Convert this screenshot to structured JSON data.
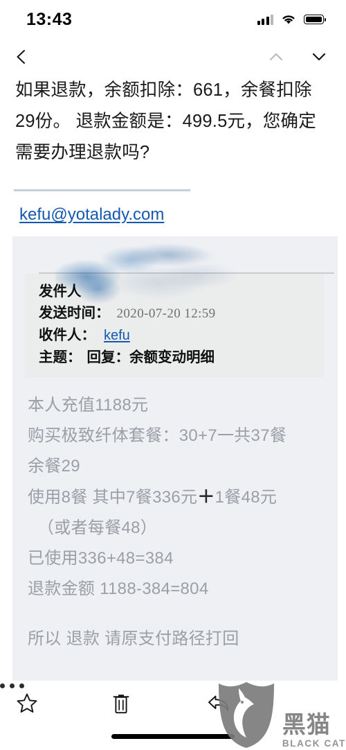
{
  "status_bar": {
    "time": "13:43",
    "icons": [
      "signal-icon",
      "wifi-icon",
      "battery-icon"
    ]
  },
  "nav_bar": {
    "back_icon": "chevron-left-icon",
    "prev_icon": "chevron-up-icon",
    "next_icon": "chevron-down-icon"
  },
  "message": {
    "body": "如果退款，余额扣除：661，余餐扣除29份。 退款金额是：499.5元，您确定需要办理退款吗?",
    "email_link": "kefu@yotalady.com"
  },
  "quoted_email": {
    "header": {
      "sender_label": "发件人",
      "sender_value": "",
      "time_label": "发送时间：",
      "time_value": "2020-07-20 12:59",
      "to_label": "收件人：",
      "to_value": "kefu",
      "subject_label": "主题：",
      "subject_value": "回复：余额变动明细"
    },
    "lines": [
      "本人充值1188元",
      "购买极致纤体套餐：30+7一共37餐",
      "余餐29",
      "使用8餐 其中7餐336元",
      "＋",
      "1餐48元",
      "（或者每餐48）",
      "已使用336+48=384",
      "退款金额 1188-384=804",
      "所以 退款 请原支付路径打回"
    ],
    "line_used_a": "使用8餐 其中7餐336元",
    "line_used_plus": "＋",
    "line_used_b": "1餐48元",
    "line_or": "（或者每餐48）",
    "line_usedtotal": "已使用336+48=384",
    "line_refund": "退款金额 1188-384=804",
    "line_final": "所以 退款 请原支付路径打回",
    "line_recharge": "本人充值1188元",
    "line_package": "购买极致纤体套餐：30+7一共37餐",
    "line_remaining": "余餐29"
  },
  "toolbar": {
    "favorite_icon": "star-icon",
    "delete_icon": "trash-icon",
    "reply_icon": "reply-arrow-icon",
    "more_icon": "more-dots-icon"
  },
  "watermark": {
    "cn": "黑猫",
    "en": "BLACK CAT"
  },
  "colors": {
    "link": "#1558b0",
    "quote_bg": "#eef0f3",
    "quote_header_bg": "#ebecec",
    "quote_text": "#9b9fa6",
    "divider": "#c6cede"
  }
}
